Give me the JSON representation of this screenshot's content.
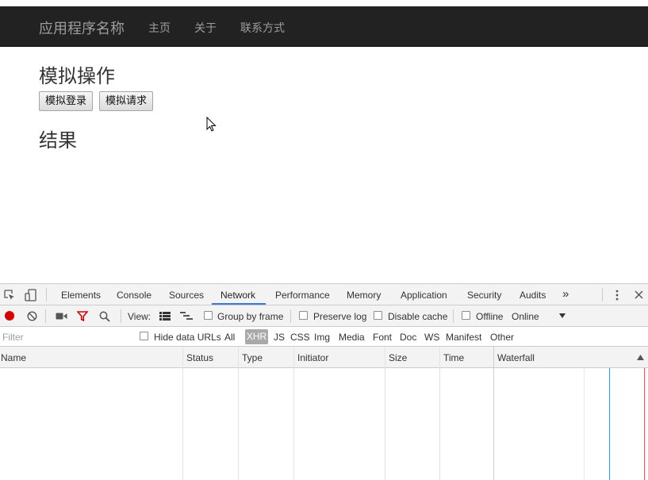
{
  "navbar": {
    "brand": "应用程序名称",
    "links": [
      "主页",
      "关于",
      "联系方式"
    ]
  },
  "content": {
    "heading_sim": "模拟操作",
    "btn_login": "模拟登录",
    "btn_request": "模拟请求",
    "heading_result": "结果"
  },
  "devtools": {
    "tabs": [
      "Elements",
      "Console",
      "Sources",
      "Network",
      "Performance",
      "Memory",
      "Application",
      "Security",
      "Audits"
    ],
    "active_tab": "Network",
    "more_tabs": "»",
    "toolbar": {
      "view_label": "View:",
      "group_by_frame": "Group by frame",
      "preserve_log": "Preserve log",
      "disable_cache": "Disable cache",
      "offline": "Offline",
      "throttle": "Online"
    },
    "filter": {
      "placeholder": "Filter",
      "hide_data_urls": "Hide data URLs",
      "types": [
        "All",
        "XHR",
        "JS",
        "CSS",
        "Img",
        "Media",
        "Font",
        "Doc",
        "WS",
        "Manifest",
        "Other"
      ],
      "active_type": "XHR"
    },
    "columns": [
      "Name",
      "Status",
      "Type",
      "Initiator",
      "Size",
      "Time",
      "Waterfall"
    ],
    "colors": {
      "accent": "#3879d9",
      "record": "#d80000",
      "filter_icon": "#d80000"
    }
  }
}
